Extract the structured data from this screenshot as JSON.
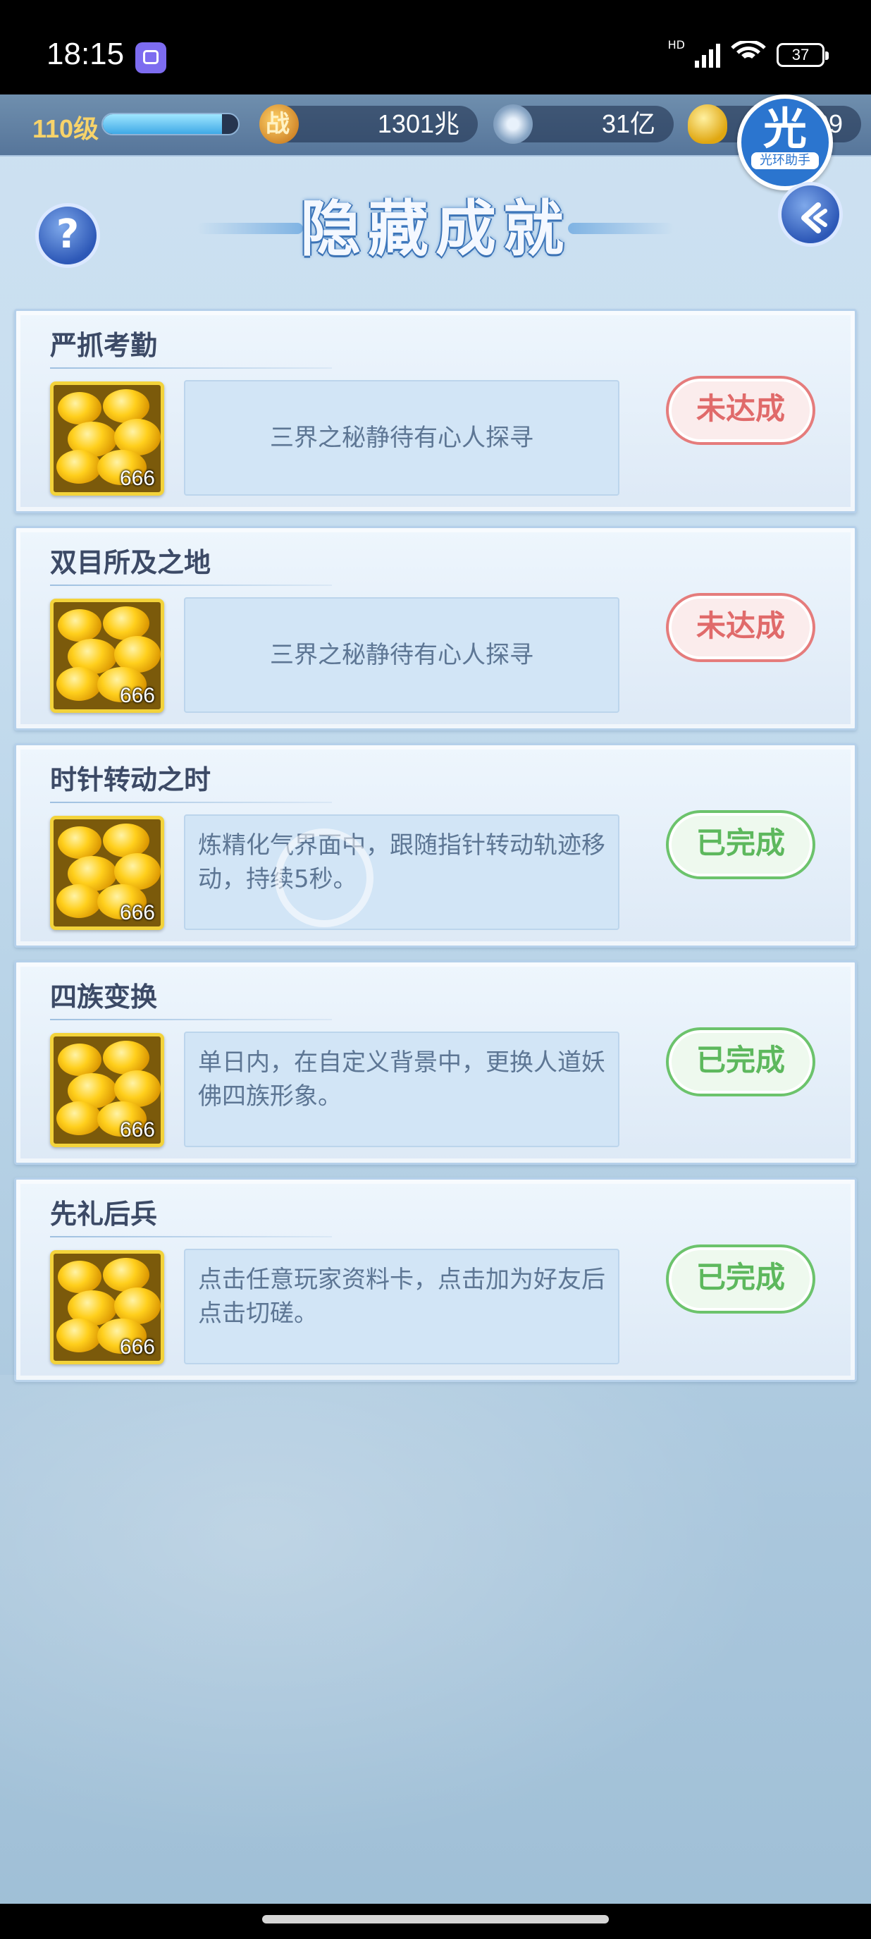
{
  "status_bar": {
    "time": "18:15",
    "network": "HD",
    "battery": "37"
  },
  "top_bar": {
    "level": "110级",
    "exp_fraction": 0.88,
    "combat_power": "1301兆",
    "silver": "31亿",
    "gold": "09"
  },
  "helper": {
    "char": "光",
    "label": "光环助手"
  },
  "page": {
    "title": "隐藏成就",
    "help": "?"
  },
  "achievements": [
    {
      "name": "严抓考勤",
      "reward_qty": "666",
      "description": "三界之秘静待有心人探寻",
      "status": "未达成",
      "state": "pending"
    },
    {
      "name": "双目所及之地",
      "reward_qty": "666",
      "description": "三界之秘静待有心人探寻",
      "status": "未达成",
      "state": "pending"
    },
    {
      "name": "时针转动之时",
      "reward_qty": "666",
      "description": "炼精化气界面中，跟随指针转动轨迹移动，持续5秒。",
      "status": "已完成",
      "state": "done"
    },
    {
      "name": "四族变换",
      "reward_qty": "666",
      "description": "单日内，在自定义背景中，更换人道妖佛四族形象。",
      "status": "已完成",
      "state": "done"
    },
    {
      "name": "先礼后兵",
      "reward_qty": "666",
      "description": "点击任意玩家资料卡，点击加为好友后点击切磋。",
      "status": "已完成",
      "state": "done"
    }
  ],
  "colors": {
    "pending": "#e06a6a",
    "done": "#5db85d",
    "title_glow": "#3d7cc6"
  }
}
